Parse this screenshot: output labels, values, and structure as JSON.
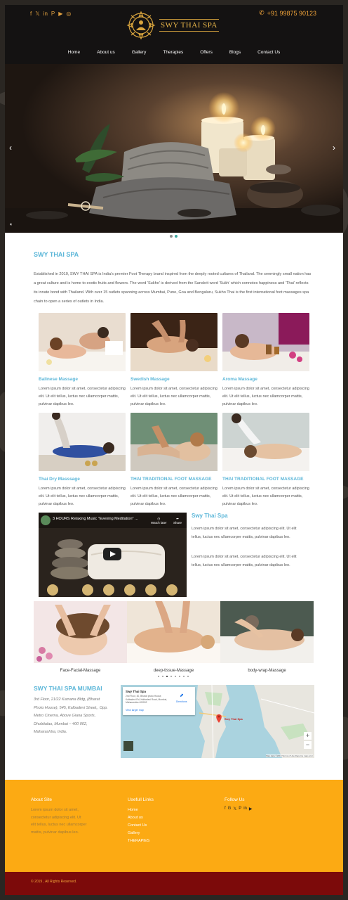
{
  "header": {
    "social_icons": [
      "facebook-icon",
      "twitter-icon",
      "linkedin-icon",
      "pinterest-icon",
      "youtube-icon",
      "instagram-icon"
    ],
    "social_glyphs": [
      "f",
      "𝕏",
      "in",
      "P",
      "▶",
      "◎"
    ],
    "phone": "+91 99875 90123",
    "logo_text": "SWY THAI SPA",
    "nav": [
      "Home",
      "About us",
      "Gallery",
      "Therapies",
      "Offers",
      "Blogs",
      "Contact Us"
    ]
  },
  "hero": {
    "prev": "‹",
    "next": "›",
    "counter": "4",
    "slide_count": 2,
    "active_dot": 1
  },
  "about": {
    "title": "SWY THAI SPA",
    "text": "Established in 2010, SWY THAI SPA is India's premier Foot Therapy brand inspired from the deeply rooted cultures of Thailand. The seemingly small nation has a great culture and is home to exotic fruits and flowers. The word 'Sukho' is derived from the Sanskrit word 'Sukh' which connotes happiness and 'Thai' reflects its innate bond with Thailand. With over 15 outlets spanning across Mumbai, Pune, Goa and Bengaluru, Sukho Thai is the first international foot massages spa chain to open a series of outlets in India."
  },
  "services": [
    {
      "title": "Balinese Massage",
      "text": "Lorem ipsum dolor sit amet, consectetur adipiscing elit. Ut elit tellus, luctus nec ullamcorper mattis, pulvinar dapibus leo."
    },
    {
      "title": "Swedish Massage",
      "text": "Lorem ipsum dolor sit amet, consectetur adipiscing elit. Ut elit tellus, luctus nec ullamcorper mattis, pulvinar dapibus leo."
    },
    {
      "title": "Aroma Massage",
      "text": "Lorem ipsum dolor sit amet, consectetur adipiscing elit. Ut elit tellus, luctus nec ullamcorper mattis, pulvinar dapibus leo."
    },
    {
      "title": "Thai Dry Masssage",
      "text": "Lorem ipsum dolor sit amet, consectetur adipiscing elit. Ut elit tellus, luctus nec ullamcorper mattis, pulvinar dapibus leo."
    },
    {
      "title": "THAI TRADITIONAL FOOT MASSAGE",
      "text": "Lorem ipsum dolor sit amet, consectetur adipiscing elit. Ut elit tellus, luctus nec ullamcorper mattis, pulvinar dapibus leo."
    },
    {
      "title": "THAI TRADITIONAL FOOT MASSAGE",
      "text": "Lorem ipsum dolor sit amet, consectetur adipiscing elit. Ut elit tellus, luctus nec ullamcorper mattis, pulvinar dapibus leo."
    }
  ],
  "video": {
    "title": "3 HOURS Relaxing Music \"Evening Meditation\" ...",
    "watch_later": "Watch later",
    "share": "Share",
    "side_title": "Swy Thai Spa",
    "side_p1": "Lorem ipsum dolor sit amet, consectetur adipiscing elit. Ut elit tellus, luctus nec ullamcorper mattis, pulvinar dapibus leo.",
    "side_p2": "Lorem ipsum dolor sit amet, consectetur adipiscing elit. Ut elit tellus, luctus nec ullamcorper mattis, pulvinar dapibus leo."
  },
  "carousel": {
    "slides": [
      "Face-Facial-Massage",
      "deep-tissue-Massage",
      "body-wrap-Massage"
    ],
    "dot_count": 8,
    "active_dot": 2
  },
  "contact": {
    "title": "SWY THAI SPA MUMBAI",
    "address": "3rd Floor, 21/22 Kamana Bldg, (Bharat Photo House), 545, Kalbadevi Street,, Opp. Metro Cinema, Above Giana Sports, Dhobitalao, Mumbai – 400 002, Maharashtra, India.",
    "map_name": "Swy Thai Spa",
    "map_address": "2nd Floor, 30, Bharat photo House, Kalbadevi Rd, Kalbadevi Road, Mumbai, Maharashtra 400002",
    "map_link": "View larger map",
    "map_directions": "Directions",
    "map_pin": "Swy Thai Spa",
    "zoom_in": "+",
    "zoom_out": "−",
    "map_footer": "Map data ©2019   Terms of Use   Report a map error"
  },
  "footer": {
    "about_title": "About Site",
    "about_text": "Lorem ipsum dolor sit amet, consectetur adipiscing elit. Ut elit tellus, luctus nec ullamcorper mattis, pulvinar dapibus leo.",
    "links_title": "Usefull Links",
    "links": [
      "Home",
      "About us",
      "Contact Us",
      "Gallery",
      "THERAPIES"
    ],
    "follow_title": "Follow Us",
    "follow_icons": [
      "facebook-icon",
      "google-plus-icon",
      "twitter-icon",
      "pinterest-icon",
      "linkedin-icon",
      "youtube-icon"
    ],
    "follow_glyphs": [
      "f",
      "G",
      "𝕏",
      "P",
      "in",
      "▶"
    ],
    "copyright": "© 2019 , All Rights Reserved."
  },
  "colors": {
    "accent_blue": "#5bb6d8",
    "gold": "#f1a43a",
    "footer_orange": "#fcaa13",
    "copyright_red": "#7c0a0a",
    "header_black": "#141212"
  }
}
